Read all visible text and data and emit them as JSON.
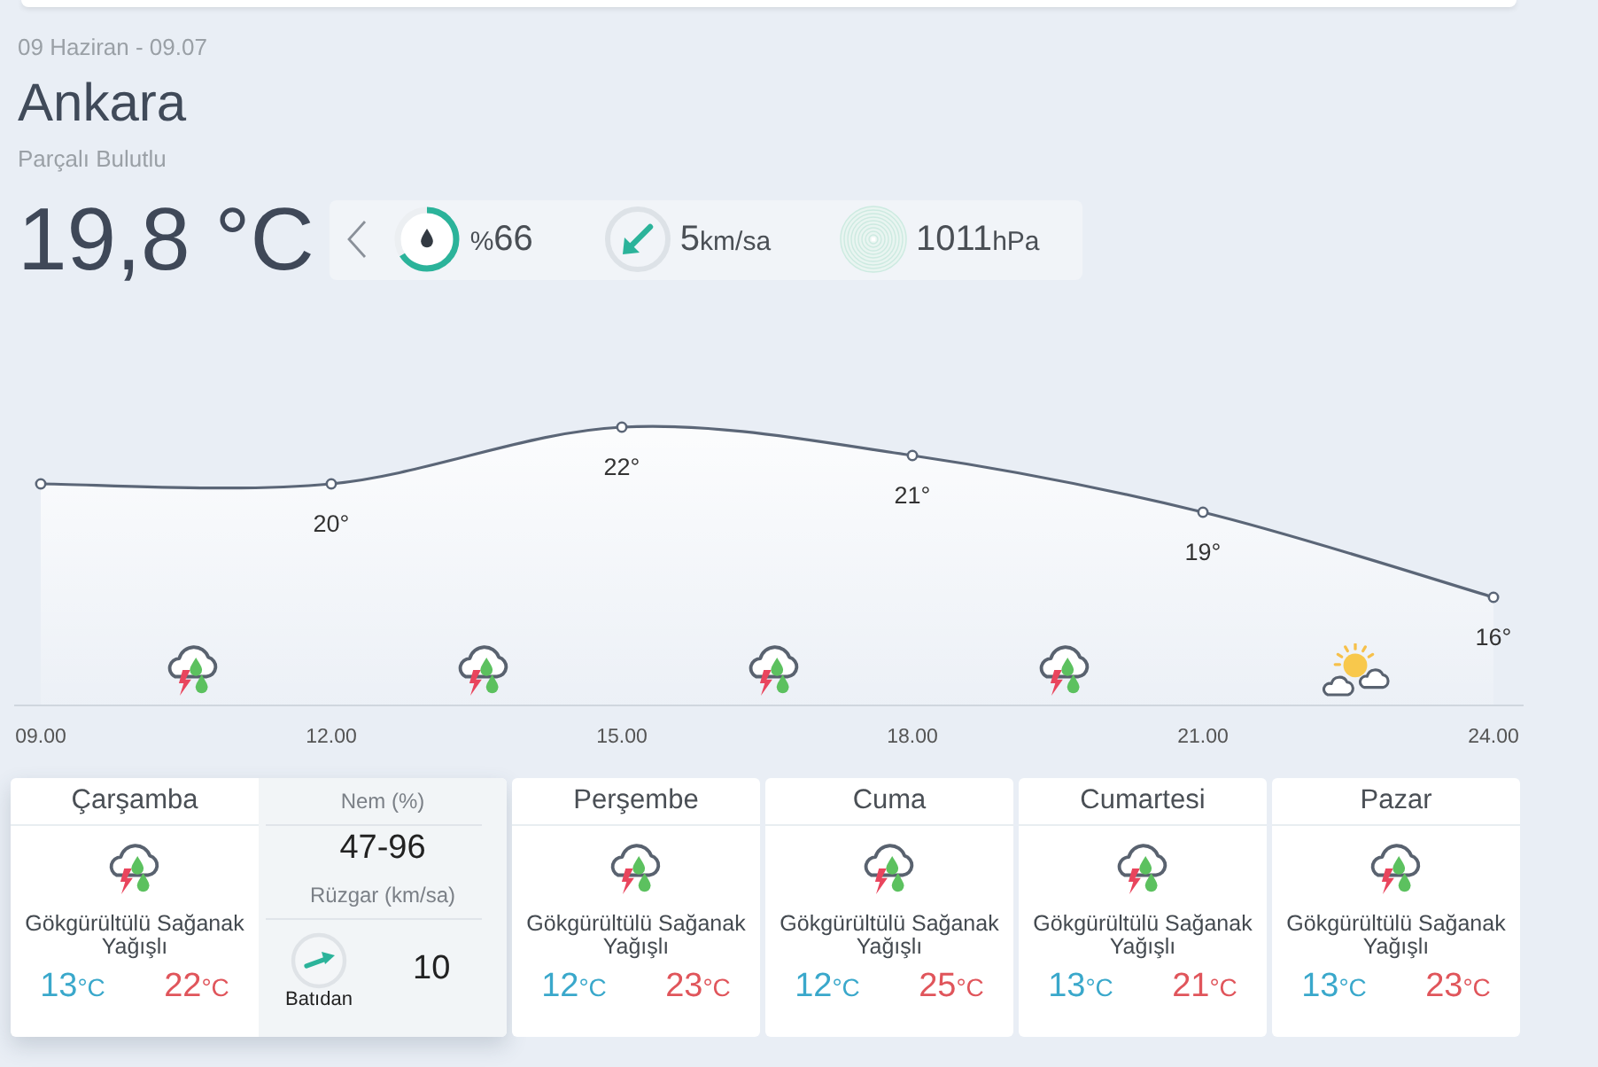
{
  "header": {
    "date": "09 Haziran - 09.07",
    "city": "Ankara",
    "condition": "Parçalı Bulutlu"
  },
  "current": {
    "temperature": "19,8 °C",
    "humidity": {
      "prefix": "%",
      "value": "66",
      "level": 0.66
    },
    "wind": {
      "value": "5",
      "unit": "km/sa"
    },
    "pressure": {
      "value": "1011",
      "unit": "hPa"
    }
  },
  "hourly": {
    "chart_data": {
      "type": "area",
      "marker": "o",
      "categories": [
        "09.00",
        "12.00",
        "15.00",
        "18.00",
        "21.00",
        "24.00"
      ],
      "values": [
        20,
        20,
        22,
        21,
        19,
        16
      ],
      "value_labels": [
        null,
        "20°",
        "22°",
        "21°",
        "19°",
        "16°"
      ]
    },
    "icons": [
      {
        "kind": "storm"
      },
      {
        "kind": "storm"
      },
      {
        "kind": "storm"
      },
      {
        "kind": "storm"
      },
      {
        "kind": "partly_sunny"
      }
    ]
  },
  "days": [
    {
      "day": "Çarşamba",
      "selected": true,
      "kind": "storm",
      "description": "Gökgürültülü Sağanak Yağışlı",
      "low": {
        "value": "13",
        "unit": "°C"
      },
      "high": {
        "value": "22",
        "unit": "°C"
      },
      "details": {
        "humidity_label": "Nem (%)",
        "humidity": "47-96",
        "wind_label": "Rüzgar (km/sa)",
        "wind_direction": "Batıdan",
        "wind_speed": "10"
      }
    },
    {
      "day": "Perşembe",
      "selected": false,
      "kind": "storm",
      "description": "Gökgürültülü Sağanak Yağışlı",
      "low": {
        "value": "12",
        "unit": "°C"
      },
      "high": {
        "value": "23",
        "unit": "°C"
      }
    },
    {
      "day": "Cuma",
      "selected": false,
      "kind": "storm",
      "description": "Gökgürültülü Sağanak Yağışlı",
      "low": {
        "value": "12",
        "unit": "°C"
      },
      "high": {
        "value": "25",
        "unit": "°C"
      }
    },
    {
      "day": "Cumartesi",
      "selected": false,
      "kind": "storm",
      "description": "Gökgürültülü Sağanak Yağışlı",
      "low": {
        "value": "13",
        "unit": "°C"
      },
      "high": {
        "value": "21",
        "unit": "°C"
      }
    },
    {
      "day": "Pazar",
      "selected": false,
      "kind": "storm",
      "description": "Gökgürültülü Sağanak Yağışlı",
      "low": {
        "value": "13",
        "unit": "°C"
      },
      "high": {
        "value": "23",
        "unit": "°C"
      }
    }
  ]
}
